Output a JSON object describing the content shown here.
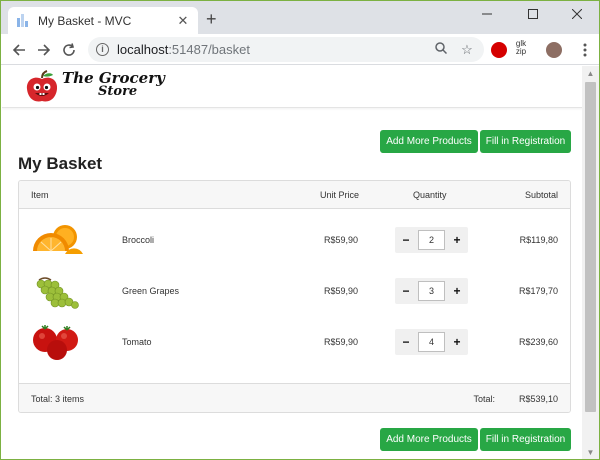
{
  "browser": {
    "tab_title": "My Basket - MVC",
    "new_tab": "+",
    "url_host": "localhost",
    "url_path": ":51487/basket",
    "ext_label": "glk zip"
  },
  "site": {
    "logo_line1": "The Grocery",
    "logo_line2": "Store"
  },
  "actions": {
    "add_more": "Add More Products",
    "registration": "Fill in Registration"
  },
  "basket": {
    "title": "My Basket",
    "columns": {
      "item": "Item",
      "unit_price": "Unit Price",
      "quantity": "Quantity",
      "subtotal": "Subtotal"
    },
    "items": [
      {
        "name": "Broccoli",
        "unit_price": "R$59,90",
        "quantity": "2",
        "subtotal": "R$119,80",
        "image": "orange-slices-image"
      },
      {
        "name": "Green Grapes",
        "unit_price": "R$59,90",
        "quantity": "3",
        "subtotal": "R$179,70",
        "image": "green-grapes-image"
      },
      {
        "name": "Tomato",
        "unit_price": "R$59,90",
        "quantity": "4",
        "subtotal": "R$239,60",
        "image": "tomatoes-image"
      }
    ],
    "footer": {
      "count": "Total: 3 items",
      "total_label": "Total:",
      "total_value": "R$539,10"
    }
  },
  "colors": {
    "accent_green": "#28a745",
    "window_border": "#7cb142"
  }
}
